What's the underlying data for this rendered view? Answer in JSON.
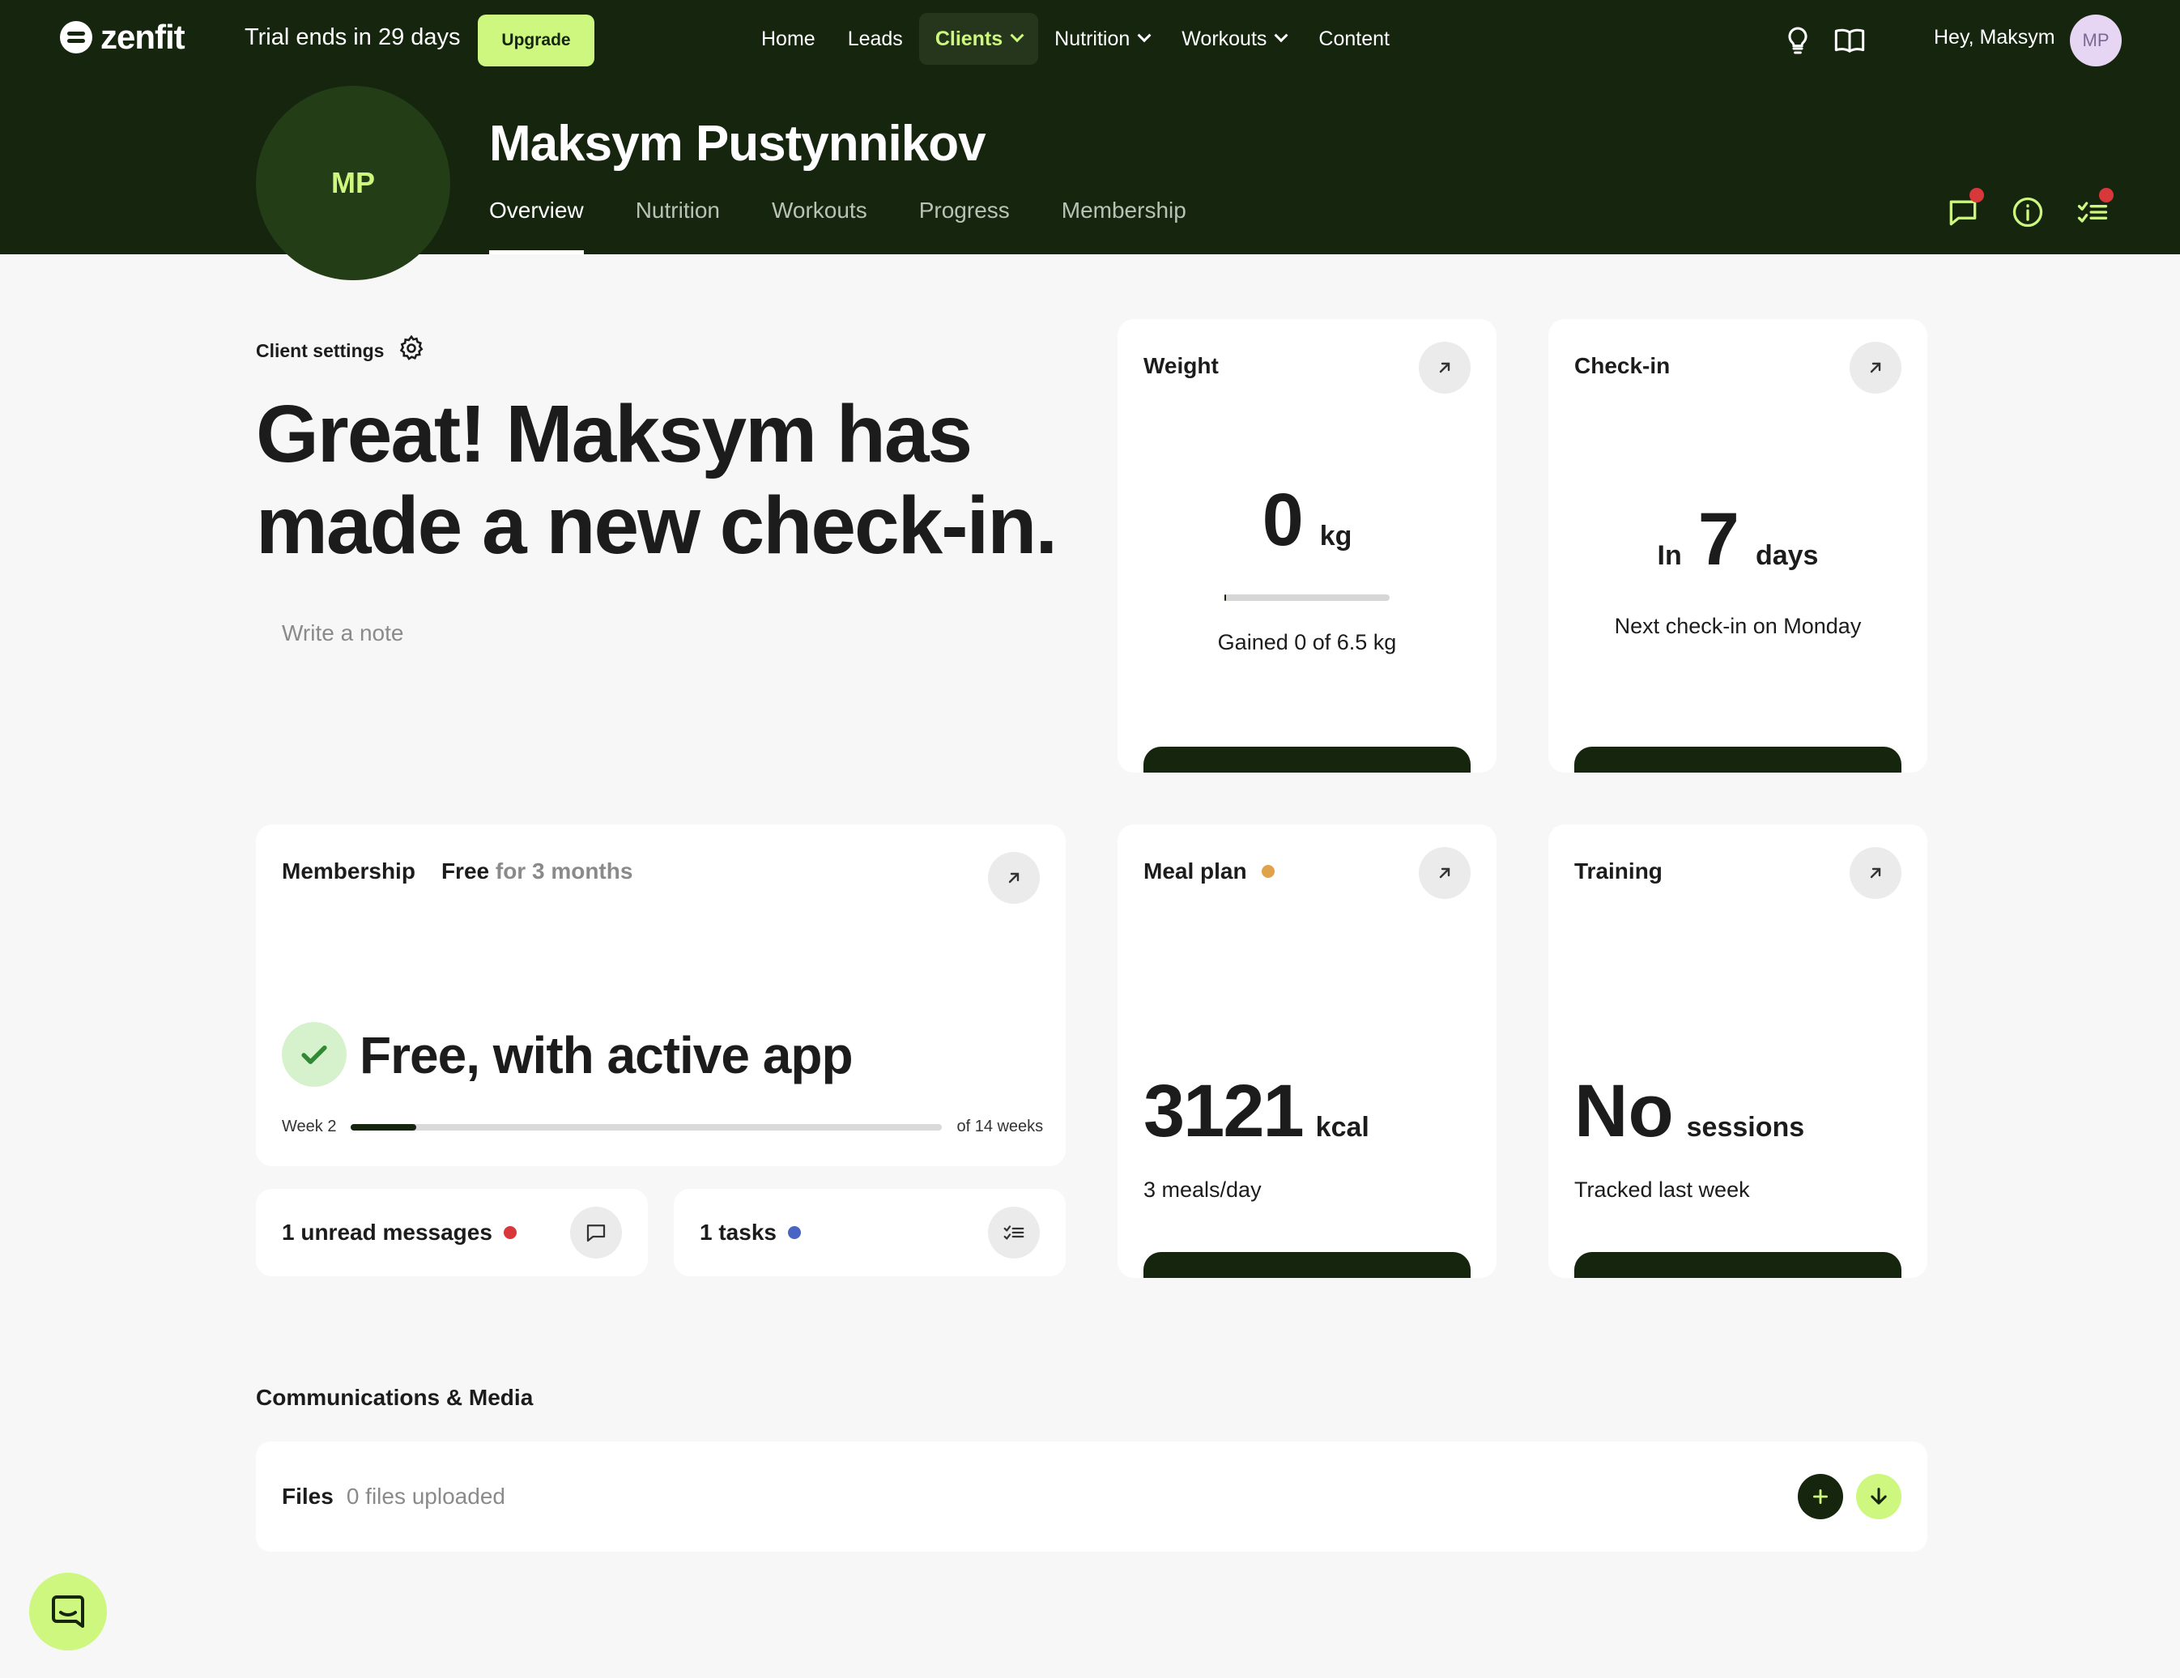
{
  "brand": {
    "name": "zenfit",
    "accent": "#cdf77f",
    "dark": "#15250e"
  },
  "topbar": {
    "trial_text": "Trial ends in 29 days",
    "upgrade_label": "Upgrade",
    "nav": [
      {
        "label": "Home",
        "active": false,
        "dropdown": false
      },
      {
        "label": "Leads",
        "active": false,
        "dropdown": false
      },
      {
        "label": "Clients",
        "active": true,
        "dropdown": true
      },
      {
        "label": "Nutrition",
        "active": false,
        "dropdown": true
      },
      {
        "label": "Workouts",
        "active": false,
        "dropdown": true
      },
      {
        "label": "Content",
        "active": false,
        "dropdown": false
      }
    ],
    "greeting": "Hey, Maksym",
    "avatar_initials": "MP",
    "icons": [
      "lightbulb-icon",
      "book-icon"
    ]
  },
  "client": {
    "initials": "MP",
    "name": "Maksym Pustynnikov",
    "tabs": [
      "Overview",
      "Nutrition",
      "Workouts",
      "Progress",
      "Membership"
    ],
    "active_tab": "Overview",
    "header_icons": [
      "chat-icon",
      "info-icon",
      "tasks-icon"
    ]
  },
  "overview": {
    "settings_label": "Client settings",
    "headline": "Great! Maksym has made a new check-in.",
    "note_placeholder": "Write a note"
  },
  "weight": {
    "title": "Weight",
    "value": "0",
    "unit": "kg",
    "caption": "Gained 0 of 6.5 kg",
    "progress": 0
  },
  "checkin": {
    "title": "Check-in",
    "prefix": "In",
    "value": "7",
    "unit": "days",
    "caption": "Next check-in on Monday"
  },
  "membership": {
    "title": "Membership",
    "plan": "Free",
    "period": "for 3 months",
    "status": "Free, with active app",
    "week_label": "Week 2",
    "total_label": "of 14 weeks",
    "progress": 0.11
  },
  "meal_plan": {
    "title": "Meal plan",
    "status_color": "#e0a24a",
    "value": "3121",
    "unit": "kcal",
    "caption": "3 meals/day"
  },
  "training": {
    "title": "Training",
    "value": "No",
    "unit": "sessions",
    "caption": "Tracked last week"
  },
  "messages": {
    "label": "1 unread messages",
    "dot_color": "#d8383a"
  },
  "tasks": {
    "label": "1 tasks",
    "dot_color": "#4a64c4"
  },
  "comms": {
    "section_title": "Communications & Media",
    "files_label": "Files",
    "files_count": "0 files uploaded"
  }
}
